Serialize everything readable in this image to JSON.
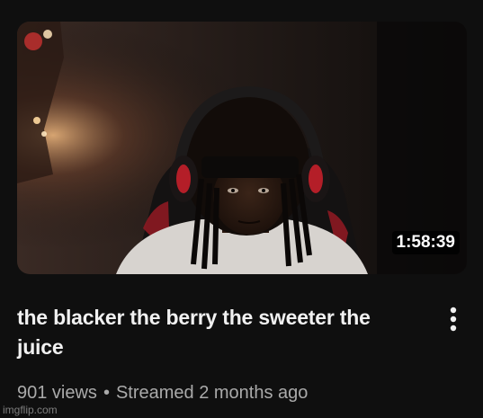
{
  "video": {
    "duration": "1:58:39",
    "title": "the blacker the berry the sweeter the juice",
    "views": "901 views",
    "separator": "•",
    "streamed": "Streamed 2 months ago"
  },
  "menu": {
    "icon": "more-vert-icon"
  },
  "watermark": {
    "text": "imgflip.com"
  },
  "colors": {
    "background": "#0f0f0f",
    "title": "#f1f1f1",
    "meta": "#aaaaaa",
    "headset_accent": "#b41e28"
  }
}
